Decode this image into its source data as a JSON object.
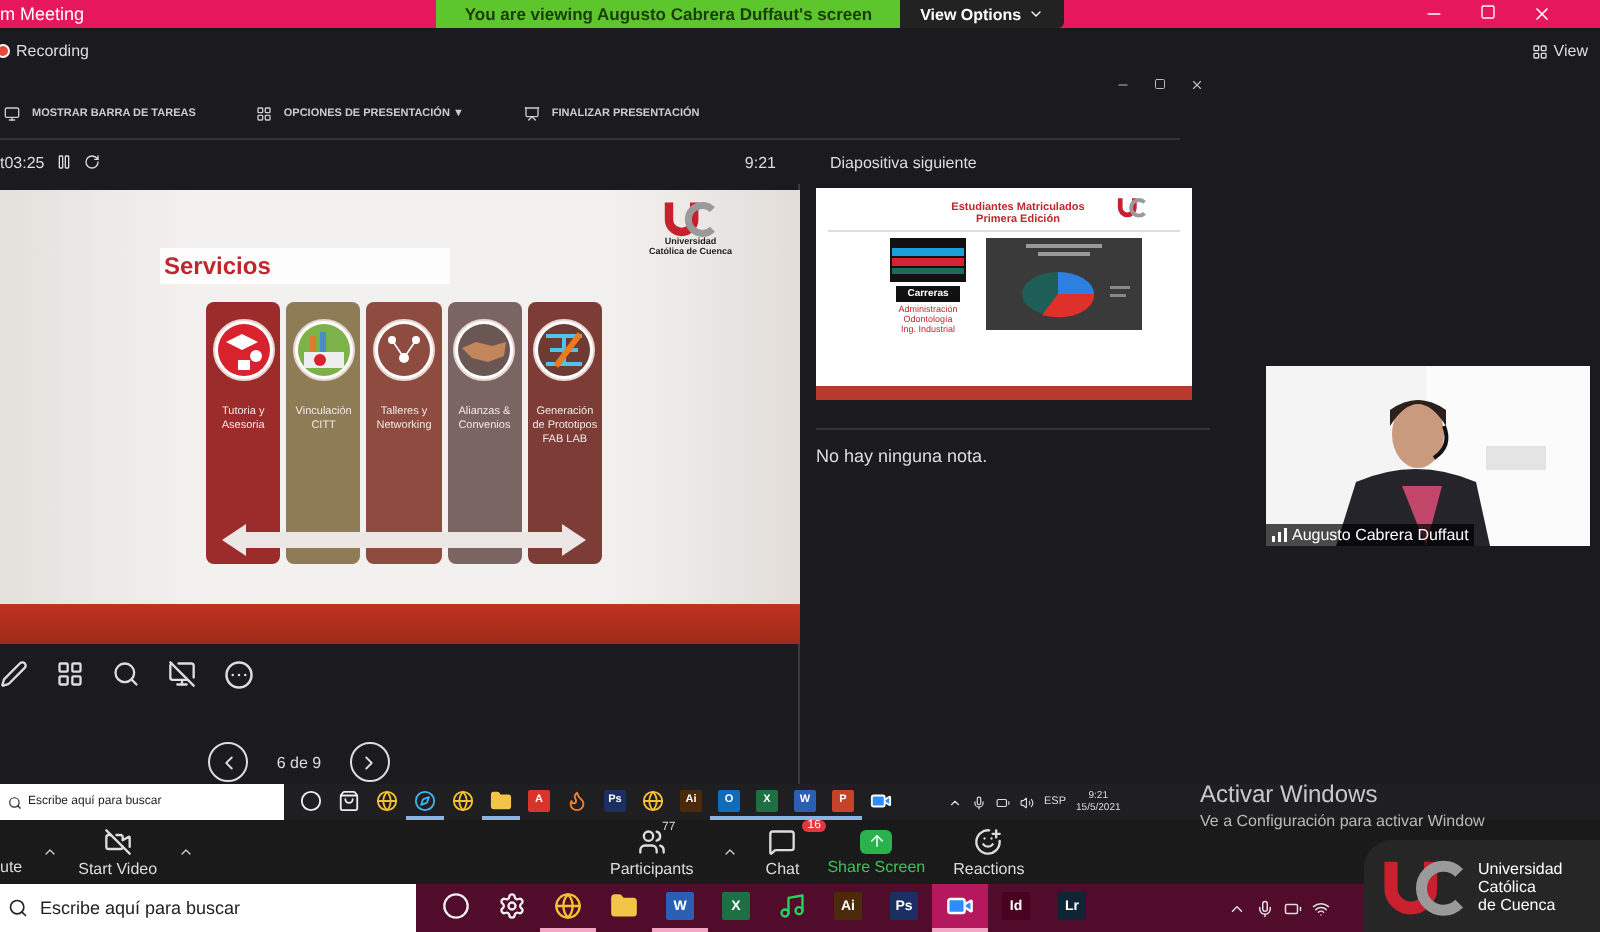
{
  "window": {
    "title": "m Meeting",
    "banner": "You are viewing Augusto Cabrera Duffaut's screen",
    "view_options": "View Options"
  },
  "recording": "Recording",
  "view_button": "View",
  "presenter": {
    "toolbar": [
      {
        "kind": "taskbar",
        "label": "MOSTRAR BARRA DE TAREAS"
      },
      {
        "kind": "options",
        "label": "OPCIONES DE PRESENTACIÓN ▼"
      },
      {
        "kind": "end",
        "label": "FINALIZAR PRESENTACIÓN"
      }
    ],
    "timer": "t03:25",
    "clock": "9:21",
    "next_label": "Diapositiva siguiente",
    "notes": "No hay ninguna nota.",
    "counter": "6 de 9",
    "slide": {
      "title": "Servicios",
      "logo": [
        "Universidad",
        "Católica de Cuenca"
      ],
      "services": [
        {
          "kind": "graduation",
          "label": "Tutoria y Asesoria",
          "color": "#9c2b2b"
        },
        {
          "kind": "chart",
          "label": "Vinculación CITT",
          "color": "#8e7c56"
        },
        {
          "kind": "network",
          "label": "Talleres y Networking",
          "color": "#8e4b40"
        },
        {
          "kind": "handshake",
          "label": "Alianzas & Convenios",
          "color": "#7b6563"
        },
        {
          "kind": "blueprint",
          "label": "Generación de Prototipos FAB LAB",
          "color": "#7e3c36"
        }
      ]
    },
    "next_slide": {
      "title": "Estudiantes Matriculados",
      "subtitle": "Primera Edición",
      "box": "Carreras",
      "careers": [
        "Administración",
        "Odontología",
        "Ing. Industrial"
      ]
    }
  },
  "video": {
    "name": "Augusto Cabrera Duffaut"
  },
  "inner_taskbar": {
    "search": "Escribe aquí para buscar",
    "apps": [
      {
        "kind": "circle",
        "selected": false
      },
      {
        "kind": "bag",
        "selected": false
      },
      {
        "kind": "globe",
        "selected": false
      },
      {
        "kind": "edge",
        "selected": true
      },
      {
        "kind": "globe",
        "selected": false
      },
      {
        "kind": "folder",
        "selected": true
      },
      {
        "kind": "app",
        "label": "A",
        "color": "#d9342b",
        "selected": false
      },
      {
        "kind": "fox",
        "selected": false
      },
      {
        "kind": "app",
        "label": "Ps",
        "color": "#1b2f63",
        "selected": false
      },
      {
        "kind": "globe",
        "selected": false
      },
      {
        "kind": "app",
        "label": "Ai",
        "color": "#4b2a0b",
        "selected": false
      },
      {
        "kind": "app",
        "label": "O",
        "color": "#0f6cbd",
        "selected": true
      },
      {
        "kind": "app",
        "label": "X",
        "color": "#1d7044",
        "selected": true
      },
      {
        "kind": "app",
        "label": "W",
        "color": "#2b5fb4",
        "selected": true
      },
      {
        "kind": "app",
        "label": "P",
        "color": "#c5432a",
        "selected": true
      },
      {
        "kind": "video",
        "selected": false
      }
    ],
    "lang": "ESP",
    "time": "9:21",
    "date": "15/5/2021"
  },
  "activation": {
    "title": "Activar Windows",
    "hint": "Ve a Configuración para activar Window"
  },
  "toolbar": {
    "left": [
      {
        "kind": "mute",
        "label": "ute"
      },
      {
        "kind": "video",
        "label": "Start Video"
      }
    ],
    "center": [
      {
        "kind": "participants",
        "label": "Participants",
        "count": "77"
      },
      {
        "kind": "chat",
        "label": "Chat",
        "badge": "16"
      },
      {
        "kind": "share",
        "label": "Share Screen"
      },
      {
        "kind": "reactions",
        "label": "Reactions"
      }
    ]
  },
  "taskbar": {
    "search": "Escribe aquí para buscar",
    "apps": [
      {
        "kind": "circle",
        "selected": false
      },
      {
        "kind": "gear",
        "selected": false
      },
      {
        "kind": "globe",
        "selected": true
      },
      {
        "kind": "folder",
        "selected": false
      },
      {
        "kind": "app",
        "label": "W",
        "color": "#2b5fb4",
        "selected": true
      },
      {
        "kind": "app",
        "label": "X",
        "color": "#1d7044",
        "selected": false
      },
      {
        "kind": "music",
        "selected": false
      },
      {
        "kind": "app",
        "label": "Ai",
        "color": "#4b2a0b",
        "selected": false
      },
      {
        "kind": "app",
        "label": "Ps",
        "color": "#1b2f63",
        "selected": false
      },
      {
        "kind": "video",
        "selected": true
      },
      {
        "kind": "app",
        "label": "Id",
        "color": "#49021f",
        "selected": false
      },
      {
        "kind": "app",
        "label": "Lr",
        "color": "#0f2536",
        "selected": false
      }
    ]
  },
  "overlay_logo": [
    "Universidad",
    "Católica",
    "de Cuenca"
  ]
}
